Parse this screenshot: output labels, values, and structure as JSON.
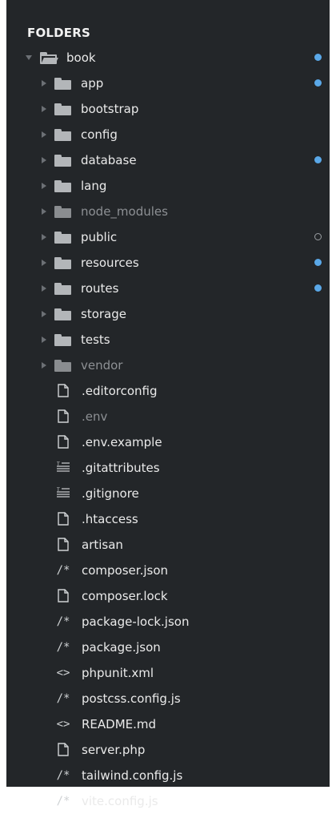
{
  "sidebar": {
    "header": "FOLDERS",
    "root": {
      "label": "book",
      "indicator": "dot"
    },
    "folders": [
      {
        "label": "app",
        "dim": false,
        "indicator": "dot"
      },
      {
        "label": "bootstrap",
        "dim": false,
        "indicator": ""
      },
      {
        "label": "config",
        "dim": false,
        "indicator": ""
      },
      {
        "label": "database",
        "dim": false,
        "indicator": "dot"
      },
      {
        "label": "lang",
        "dim": false,
        "indicator": ""
      },
      {
        "label": "node_modules",
        "dim": true,
        "indicator": ""
      },
      {
        "label": "public",
        "dim": false,
        "indicator": "hollow"
      },
      {
        "label": "resources",
        "dim": false,
        "indicator": "dot"
      },
      {
        "label": "routes",
        "dim": false,
        "indicator": "dot"
      },
      {
        "label": "storage",
        "dim": false,
        "indicator": ""
      },
      {
        "label": "tests",
        "dim": false,
        "indicator": ""
      },
      {
        "label": "vendor",
        "dim": true,
        "indicator": ""
      }
    ],
    "files": [
      {
        "label": ".editorconfig",
        "icon": "file-icon",
        "dim": false
      },
      {
        "label": ".env",
        "icon": "file-icon",
        "dim": true
      },
      {
        "label": ".env.example",
        "icon": "file-icon",
        "dim": false
      },
      {
        "label": ".gitattributes",
        "icon": "text-lines-icon",
        "dim": false
      },
      {
        "label": ".gitignore",
        "icon": "text-lines-icon",
        "dim": false
      },
      {
        "label": ".htaccess",
        "icon": "file-icon",
        "dim": false
      },
      {
        "label": "artisan",
        "icon": "file-icon",
        "dim": false
      },
      {
        "label": "composer.json",
        "icon": "comment-icon",
        "dim": false
      },
      {
        "label": "composer.lock",
        "icon": "file-icon",
        "dim": false
      },
      {
        "label": "package-lock.json",
        "icon": "comment-icon",
        "dim": false
      },
      {
        "label": "package.json",
        "icon": "comment-icon",
        "dim": false
      },
      {
        "label": "phpunit.xml",
        "icon": "code-icon",
        "dim": false
      },
      {
        "label": "postcss.config.js",
        "icon": "comment-icon",
        "dim": false
      },
      {
        "label": "README.md",
        "icon": "code-icon",
        "dim": false
      },
      {
        "label": "server.php",
        "icon": "file-icon",
        "dim": false
      },
      {
        "label": "tailwind.config.js",
        "icon": "comment-icon",
        "dim": false
      },
      {
        "label": "vite.config.js",
        "icon": "comment-icon",
        "dim": false
      }
    ],
    "colors": {
      "background": "#232629",
      "modified_dot": "#5aa8e8",
      "untracked_dot": "#9a9ea2"
    }
  }
}
